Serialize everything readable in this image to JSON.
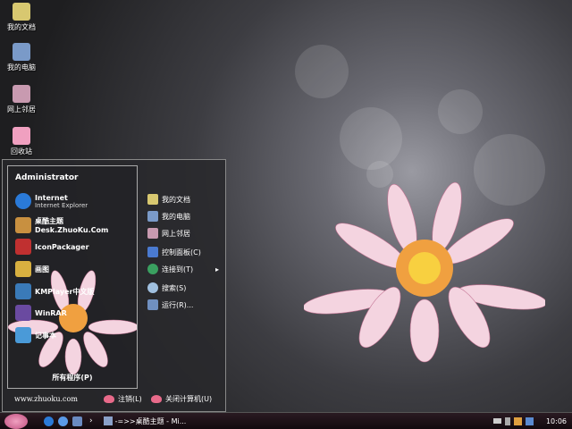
{
  "desktop": {
    "icons": [
      {
        "label": "我的文档",
        "color": "#d8c870"
      },
      {
        "label": "我的电脑",
        "color": "#7a9ac8"
      },
      {
        "label": "网上邻居",
        "color": "#c89ab0"
      },
      {
        "label": "回收站",
        "color": "#f0a0c0"
      }
    ]
  },
  "start_menu": {
    "user": "Administrator",
    "programs": [
      {
        "label": "Internet",
        "sub": "Internet Explorer",
        "color": "#2a7ad8"
      },
      {
        "label": "桌酷主题Desk.ZhuoKu.Com",
        "color": "#c89040"
      },
      {
        "label": "IconPackager",
        "color": "#c03030"
      },
      {
        "label": "画图",
        "color": "#d8b040"
      },
      {
        "label": "KMPlayer中文版",
        "color": "#3a7ab8"
      },
      {
        "label": "WinRAR",
        "color": "#6a4aa0"
      },
      {
        "label": "记事本",
        "color": "#4a9ad8"
      }
    ],
    "all_programs": "所有程序(P)",
    "right_items": [
      {
        "label": "我的文档",
        "color": "#d8c870"
      },
      {
        "label": "我的电脑",
        "color": "#7a9ac8"
      },
      {
        "label": "网上邻居",
        "color": "#c89ab0"
      },
      {
        "label": "控制面板(C)",
        "color": "#4a7ad0"
      },
      {
        "label": "连接到(T)",
        "color": "#3aa060",
        "arrow": "▸"
      },
      {
        "label": "搜索(S)",
        "color": "#a0c0e0"
      },
      {
        "label": "运行(R)...",
        "color": "#7090c0"
      }
    ],
    "website": "www.zhuoku.com",
    "logoff": "注销(L)",
    "shutdown": "关闭计算机(U)"
  },
  "taskbar": {
    "task": "-=>>桌酷主题 - Mi...",
    "clock": "10:06",
    "chevron": "›"
  }
}
